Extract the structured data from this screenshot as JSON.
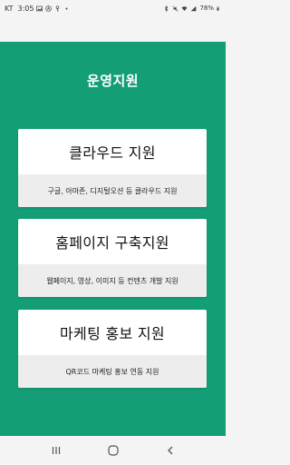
{
  "status_bar": {
    "carrier": "KT",
    "time": "3:05",
    "battery": "78%"
  },
  "page": {
    "title": "운영지원"
  },
  "cards": [
    {
      "title": "클라우드 지원",
      "description": "구글, 아마존, 디지털오션 등 클라우드 지원"
    },
    {
      "title": "홈페이지 구축지원",
      "description": "웹페이지, 영상, 이미지 등 컨텐츠 개발 지원"
    },
    {
      "title": "마케팅 홍보 지원",
      "description": "QR코드 마케팅 홍보 연동 지원"
    }
  ],
  "colors": {
    "accent": "#149e75",
    "card_bg": "#ffffff",
    "card_desc_bg": "#ededed",
    "background": "#f4f4f4"
  },
  "icons": {
    "status_left": [
      "image-icon",
      "a-circle-icon",
      "key-icon",
      "dot-icon"
    ],
    "status_right": [
      "bluetooth-icon",
      "mute-icon",
      "wifi-icon",
      "signal-icon",
      "battery-icon"
    ],
    "nav": [
      "recents-icon",
      "home-icon",
      "back-icon"
    ]
  }
}
